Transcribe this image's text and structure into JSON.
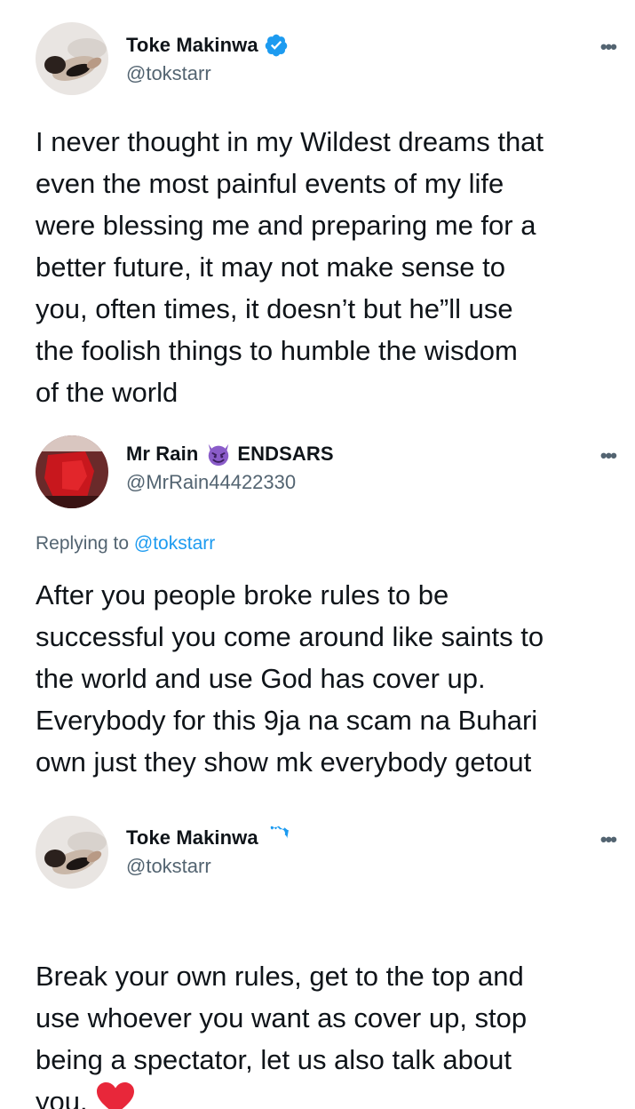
{
  "tweets": [
    {
      "author": {
        "display_name": "Toke Makinwa",
        "handle": "@tokstarr",
        "verified": true
      },
      "text": "I never thought in my Wildest dreams that\neven the most painful events of my life\nwere blessing me and preparing me for a\nbetter future, it may not make sense to\nyou, often times, it doesn’t but he”ll use\nthe foolish things to humble the wisdom\nof the world"
    },
    {
      "author": {
        "display_name_prefix": "Mr Rain",
        "display_name_suffix": "ENDSARS",
        "handle": "@MrRain44422330",
        "verified": false
      },
      "replying_label": "Replying to",
      "replying_to": "@tokstarr",
      "text": "After you people broke rules to be\nsuccessful you come around like saints to\nthe world and use God has cover up.\nEverybody for this 9ja na scam na Buhari\nown just they show mk everybody getout"
    },
    {
      "author": {
        "display_name": "Toke Makinwa",
        "handle": "@tokstarr",
        "verified": true
      },
      "text": "Break your own rules, get to the top and\nuse whoever you want as cover up, stop\nbeing a spectator, let us also talk about\nyou."
    }
  ],
  "more_label": "•••",
  "colors": {
    "verified": "#1d9bf0",
    "mention": "#1d9bf0",
    "secondary_text": "#536471",
    "heart": "#e8273a",
    "devil": "#8a5cc9"
  }
}
